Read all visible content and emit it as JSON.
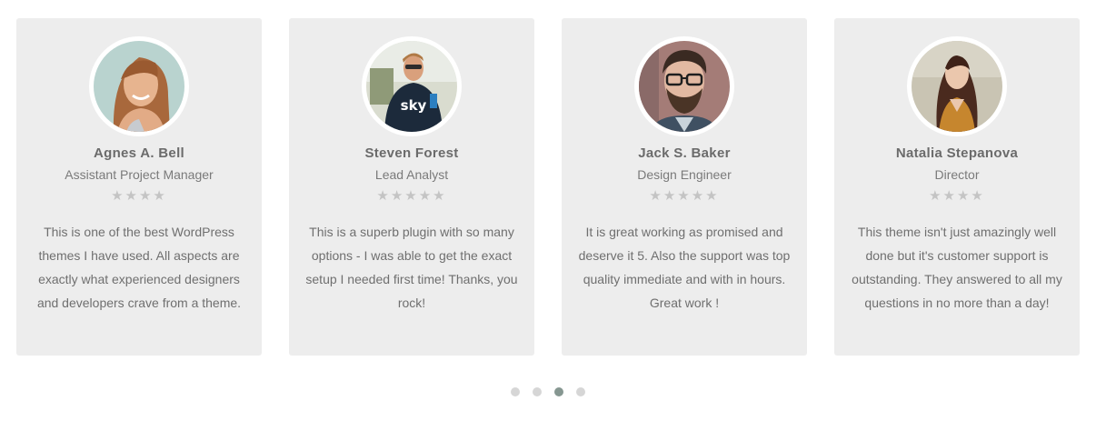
{
  "testimonials": [
    {
      "name": "Agnes A. Bell",
      "role": "Assistant Project Manager",
      "stars": "★★★★",
      "quote": "This is one of the best WordPress themes I have used. All aspects are exactly what experienced designers and developers crave from a theme.",
      "avatar_icon": "woman-portrait"
    },
    {
      "name": "Steven Forest",
      "role": "Lead Analyst",
      "stars": "★★★★★",
      "quote": "This is a superb plugin with so many options - I was able to get the exact setup I needed first time! Thanks, you rock!",
      "avatar_icon": "man-sunglasses-portrait"
    },
    {
      "name": "Jack S. Baker",
      "role": "Design Engineer",
      "stars": "★★★★★",
      "quote": "It is great working as promised and deserve it 5. Also the support was top quality immediate and with in hours. Great work !",
      "avatar_icon": "man-glasses-beard-portrait"
    },
    {
      "name": "Natalia Stepanova",
      "role": "Director",
      "stars": "★★★★",
      "quote": "This theme isn't just amazingly well done but it's customer support is outstanding. They answered to all my questions in no more than a day!",
      "avatar_icon": "woman-long-hair-portrait"
    }
  ],
  "pagination": {
    "total": 4,
    "active_index": 3
  },
  "colors": {
    "card_background": "#ededed",
    "star": "#c4c4c4",
    "dot_inactive": "#d6d6d6",
    "dot_active": "#869791"
  }
}
